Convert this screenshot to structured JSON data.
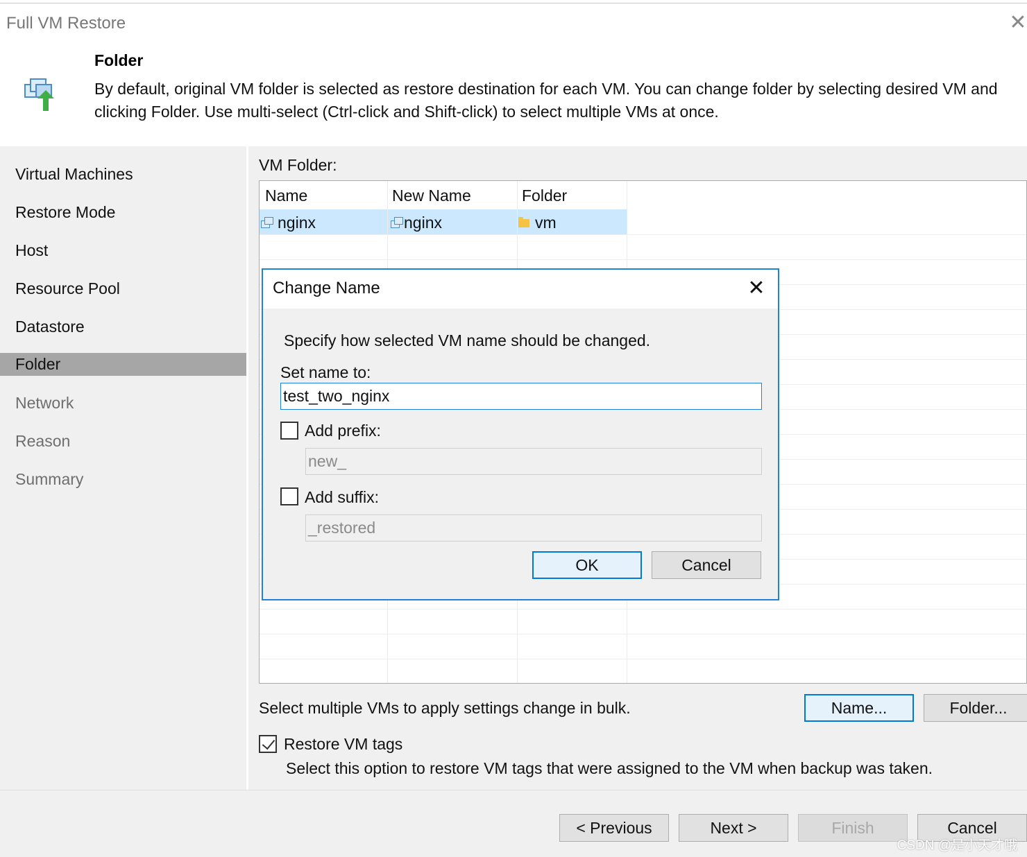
{
  "window": {
    "title": "Full VM Restore",
    "close_glyph": "✕"
  },
  "header": {
    "title": "Folder",
    "description": "By default, original VM folder is selected as restore destination for each VM. You can change folder by selecting desired VM and clicking Folder. Use multi-select (Ctrl-click and Shift-click) to select multiple VMs at once."
  },
  "steps": [
    {
      "label": "Virtual Machines",
      "state": "done"
    },
    {
      "label": "Restore Mode",
      "state": "done"
    },
    {
      "label": "Host",
      "state": "done"
    },
    {
      "label": "Resource Pool",
      "state": "done"
    },
    {
      "label": "Datastore",
      "state": "done"
    },
    {
      "label": "Folder",
      "state": "active"
    },
    {
      "label": "Network",
      "state": "future"
    },
    {
      "label": "Reason",
      "state": "future"
    },
    {
      "label": "Summary",
      "state": "future"
    }
  ],
  "vm_folder": {
    "label": "VM Folder:",
    "columns": [
      "Name",
      "New Name",
      "Folder"
    ],
    "rows": [
      {
        "name": "nginx",
        "new_name": "nginx",
        "folder": "vm",
        "selected": true
      }
    ]
  },
  "bulk": {
    "text": "Select multiple VMs to apply settings change in bulk.",
    "name_button": "Name...",
    "folder_button": "Folder..."
  },
  "tags": {
    "checked": true,
    "label": "Restore VM tags",
    "description": "Select this option to restore VM tags that were assigned to the VM when backup was taken."
  },
  "footer": {
    "previous": "< Previous",
    "next": "Next >",
    "finish": "Finish",
    "cancel": "Cancel"
  },
  "dialog": {
    "title": "Change Name",
    "close_glyph": "✕",
    "instruction": "Specify how selected VM name should be changed.",
    "set_name_label": "Set name to:",
    "set_name_value": "test_two_nginx",
    "prefix": {
      "checked": false,
      "label": "Add prefix:",
      "value": "new_"
    },
    "suffix": {
      "checked": false,
      "label": "Add suffix:",
      "value": "_restored"
    },
    "ok": "OK",
    "cancel": "Cancel"
  },
  "watermark": "CSDN @是小天才哦",
  "colors": {
    "accent": "#1e82d6",
    "selection": "#cce8ff",
    "panel": "#f0f0f0",
    "active_step": "#a6a6a6"
  }
}
